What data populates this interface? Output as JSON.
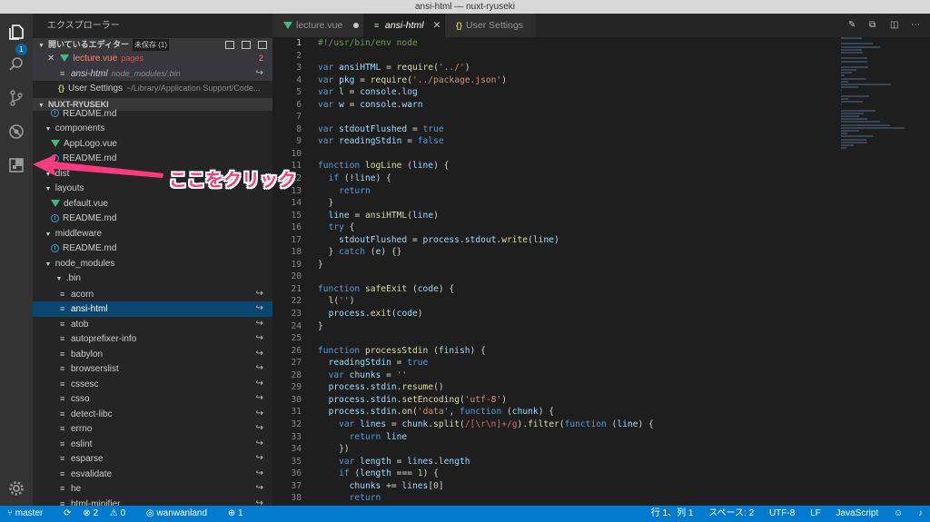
{
  "window": {
    "title": "ansi-html — nuxt-ryuseki"
  },
  "activity_bar": {
    "icons": [
      "files-icon",
      "search-icon",
      "source-control-icon",
      "debug-icon",
      "extensions-icon",
      "gear-icon"
    ],
    "badge": "1"
  },
  "sidebar": {
    "title": "エクスプローラー",
    "open_editors": {
      "label": "開いているエディター",
      "tag": "未保存 (1)",
      "items": [
        {
          "name": "lecture.vue",
          "desc": "pages",
          "count": "2"
        },
        {
          "name": "ansi-html",
          "desc": "node_modules/.bin"
        },
        {
          "name": "User Settings",
          "desc": "~/Library/Application Support/Code..."
        }
      ]
    },
    "project": {
      "label": "NUXT-RYUSEKI",
      "rows": [
        {
          "label": "README.md",
          "type": "info",
          "indent": 1
        },
        {
          "label": "components",
          "type": "folder-open",
          "indent": 0
        },
        {
          "label": "AppLogo.vue",
          "type": "vue",
          "indent": 1
        },
        {
          "label": "README.md",
          "type": "info",
          "indent": 1
        },
        {
          "label": "dist",
          "type": "folder-open",
          "indent": 0
        },
        {
          "label": "layouts",
          "type": "folder-open",
          "indent": 0
        },
        {
          "label": "default.vue",
          "type": "vue",
          "indent": 1
        },
        {
          "label": "README.md",
          "type": "info",
          "indent": 1
        },
        {
          "label": "middleware",
          "type": "folder-open",
          "indent": 0
        },
        {
          "label": "README.md",
          "type": "info",
          "indent": 1
        },
        {
          "label": "node_modules",
          "type": "folder-open",
          "indent": 0
        },
        {
          "label": ".bin",
          "type": "folder-open",
          "indent": 1
        },
        {
          "label": "acorn",
          "type": "file",
          "indent": 2,
          "link": true
        },
        {
          "label": "ansi-html",
          "type": "file",
          "indent": 2,
          "link": true,
          "selected": true
        },
        {
          "label": "atob",
          "type": "file",
          "indent": 2,
          "link": true
        },
        {
          "label": "autoprefixer-info",
          "type": "file",
          "indent": 2,
          "link": true
        },
        {
          "label": "babylon",
          "type": "file",
          "indent": 2,
          "link": true
        },
        {
          "label": "browserslist",
          "type": "file",
          "indent": 2,
          "link": true
        },
        {
          "label": "cssesc",
          "type": "file",
          "indent": 2,
          "link": true
        },
        {
          "label": "csso",
          "type": "file",
          "indent": 2,
          "link": true
        },
        {
          "label": "detect-libc",
          "type": "file",
          "indent": 2,
          "link": true
        },
        {
          "label": "errno",
          "type": "file",
          "indent": 2,
          "link": true
        },
        {
          "label": "eslint",
          "type": "file",
          "indent": 2,
          "link": true
        },
        {
          "label": "esparse",
          "type": "file",
          "indent": 2,
          "link": true
        },
        {
          "label": "esvalidate",
          "type": "file",
          "indent": 2,
          "link": true
        },
        {
          "label": "he",
          "type": "file",
          "indent": 2,
          "link": true
        },
        {
          "label": "html-minifier",
          "type": "file",
          "indent": 2,
          "link": true
        }
      ]
    }
  },
  "editor": {
    "tabs": [
      {
        "label": "lecture.vue",
        "icon": "vue",
        "dirty": true
      },
      {
        "label": "ansi-html",
        "icon": "file",
        "active": true
      },
      {
        "label": "User Settings",
        "icon": "json"
      }
    ],
    "lines": [
      {
        "n": "1",
        "c": [
          [
            "cm",
            "#!/usr/bin/env node"
          ]
        ]
      },
      {
        "n": "2",
        "c": []
      },
      {
        "n": "3",
        "c": [
          [
            "kw",
            "var "
          ],
          [
            "va",
            "ansiHTML"
          ],
          [
            "pl",
            " = "
          ],
          [
            "fn",
            "require"
          ],
          [
            "pl",
            "("
          ],
          [
            "st",
            "'../'"
          ],
          [
            "pl",
            ")"
          ]
        ]
      },
      {
        "n": "4",
        "c": [
          [
            "kw",
            "var "
          ],
          [
            "va",
            "pkg"
          ],
          [
            "pl",
            " = "
          ],
          [
            "fn",
            "require"
          ],
          [
            "pl",
            "("
          ],
          [
            "st",
            "'../package.json'"
          ],
          [
            "pl",
            ")"
          ]
        ]
      },
      {
        "n": "5",
        "c": [
          [
            "kw",
            "var "
          ],
          [
            "va",
            "l"
          ],
          [
            "pl",
            " = "
          ],
          [
            "va",
            "console"
          ],
          [
            "pl",
            "."
          ],
          [
            "va",
            "log"
          ]
        ]
      },
      {
        "n": "6",
        "c": [
          [
            "kw",
            "var "
          ],
          [
            "va",
            "w"
          ],
          [
            "pl",
            " = "
          ],
          [
            "va",
            "console"
          ],
          [
            "pl",
            "."
          ],
          [
            "va",
            "warn"
          ]
        ]
      },
      {
        "n": "7",
        "c": []
      },
      {
        "n": "8",
        "c": [
          [
            "kw",
            "var "
          ],
          [
            "va",
            "stdoutFlushed"
          ],
          [
            "pl",
            " = "
          ],
          [
            "kw",
            "true"
          ]
        ]
      },
      {
        "n": "9",
        "c": [
          [
            "kw",
            "var "
          ],
          [
            "va",
            "readingStdin"
          ],
          [
            "pl",
            " = "
          ],
          [
            "kw",
            "false"
          ]
        ]
      },
      {
        "n": "10",
        "c": []
      },
      {
        "n": "11",
        "c": [
          [
            "kw",
            "function "
          ],
          [
            "fn",
            "logLine"
          ],
          [
            "pl",
            " ("
          ],
          [
            "va",
            "line"
          ],
          [
            "pl",
            ") {"
          ]
        ]
      },
      {
        "n": "12",
        "c": [
          [
            "pl",
            "  "
          ],
          [
            "kw",
            "if"
          ],
          [
            "pl",
            " (!"
          ],
          [
            "va",
            "line"
          ],
          [
            "pl",
            ") {"
          ]
        ]
      },
      {
        "n": "13",
        "c": [
          [
            "pl",
            "    "
          ],
          [
            "kw",
            "return"
          ]
        ]
      },
      {
        "n": "14",
        "c": [
          [
            "pl",
            "  }"
          ]
        ]
      },
      {
        "n": "15",
        "c": [
          [
            "pl",
            "  "
          ],
          [
            "va",
            "line"
          ],
          [
            "pl",
            " = "
          ],
          [
            "fn",
            "ansiHTML"
          ],
          [
            "pl",
            "("
          ],
          [
            "va",
            "line"
          ],
          [
            "pl",
            ")"
          ]
        ]
      },
      {
        "n": "16",
        "c": [
          [
            "pl",
            "  "
          ],
          [
            "kw",
            "try"
          ],
          [
            "pl",
            " {"
          ]
        ]
      },
      {
        "n": "17",
        "c": [
          [
            "pl",
            "    "
          ],
          [
            "va",
            "stdoutFlushed"
          ],
          [
            "pl",
            " = "
          ],
          [
            "va",
            "process"
          ],
          [
            "pl",
            "."
          ],
          [
            "va",
            "stdout"
          ],
          [
            "pl",
            "."
          ],
          [
            "fn",
            "write"
          ],
          [
            "pl",
            "("
          ],
          [
            "va",
            "line"
          ],
          [
            "pl",
            ")"
          ]
        ]
      },
      {
        "n": "18",
        "c": [
          [
            "pl",
            "  } "
          ],
          [
            "kw",
            "catch"
          ],
          [
            "pl",
            " ("
          ],
          [
            "va",
            "e"
          ],
          [
            "pl",
            ") {}"
          ]
        ]
      },
      {
        "n": "19",
        "c": [
          [
            "pl",
            "}"
          ]
        ]
      },
      {
        "n": "20",
        "c": []
      },
      {
        "n": "21",
        "c": [
          [
            "kw",
            "function "
          ],
          [
            "fn",
            "safeExit"
          ],
          [
            "pl",
            " ("
          ],
          [
            "va",
            "code"
          ],
          [
            "pl",
            ") {"
          ]
        ]
      },
      {
        "n": "22",
        "c": [
          [
            "pl",
            "  "
          ],
          [
            "fn",
            "l"
          ],
          [
            "pl",
            "("
          ],
          [
            "st",
            "''"
          ],
          [
            "pl",
            ")"
          ]
        ]
      },
      {
        "n": "23",
        "c": [
          [
            "pl",
            "  "
          ],
          [
            "va",
            "process"
          ],
          [
            "pl",
            "."
          ],
          [
            "fn",
            "exit"
          ],
          [
            "pl",
            "("
          ],
          [
            "va",
            "code"
          ],
          [
            "pl",
            ")"
          ]
        ]
      },
      {
        "n": "24",
        "c": [
          [
            "pl",
            "}"
          ]
        ]
      },
      {
        "n": "25",
        "c": []
      },
      {
        "n": "26",
        "c": [
          [
            "kw",
            "function "
          ],
          [
            "fn",
            "processStdin"
          ],
          [
            "pl",
            " ("
          ],
          [
            "va",
            "finish"
          ],
          [
            "pl",
            ") {"
          ]
        ]
      },
      {
        "n": "27",
        "c": [
          [
            "pl",
            "  "
          ],
          [
            "va",
            "readingStdin"
          ],
          [
            "pl",
            " = "
          ],
          [
            "kw",
            "true"
          ]
        ]
      },
      {
        "n": "28",
        "c": [
          [
            "pl",
            "  "
          ],
          [
            "kw",
            "var "
          ],
          [
            "va",
            "chunks"
          ],
          [
            "pl",
            " = "
          ],
          [
            "st",
            "''"
          ]
        ]
      },
      {
        "n": "29",
        "c": [
          [
            "pl",
            "  "
          ],
          [
            "va",
            "process"
          ],
          [
            "pl",
            "."
          ],
          [
            "va",
            "stdin"
          ],
          [
            "pl",
            "."
          ],
          [
            "fn",
            "resume"
          ],
          [
            "pl",
            "()"
          ]
        ]
      },
      {
        "n": "30",
        "c": [
          [
            "pl",
            "  "
          ],
          [
            "va",
            "process"
          ],
          [
            "pl",
            "."
          ],
          [
            "va",
            "stdin"
          ],
          [
            "pl",
            "."
          ],
          [
            "fn",
            "setEncoding"
          ],
          [
            "pl",
            "("
          ],
          [
            "st",
            "'utf-8'"
          ],
          [
            "pl",
            ")"
          ]
        ]
      },
      {
        "n": "31",
        "c": [
          [
            "pl",
            "  "
          ],
          [
            "va",
            "process"
          ],
          [
            "pl",
            "."
          ],
          [
            "va",
            "stdin"
          ],
          [
            "pl",
            "."
          ],
          [
            "fn",
            "on"
          ],
          [
            "pl",
            "("
          ],
          [
            "st",
            "'data'"
          ],
          [
            "pl",
            ", "
          ],
          [
            "kw",
            "function"
          ],
          [
            "pl",
            " ("
          ],
          [
            "va",
            "chunk"
          ],
          [
            "pl",
            ") {"
          ]
        ]
      },
      {
        "n": "32",
        "c": [
          [
            "pl",
            "    "
          ],
          [
            "kw",
            "var "
          ],
          [
            "va",
            "lines"
          ],
          [
            "pl",
            " = "
          ],
          [
            "va",
            "chunk"
          ],
          [
            "pl",
            "."
          ],
          [
            "fn",
            "split"
          ],
          [
            "pl",
            "("
          ],
          [
            "rx",
            "/[\\r\\n]+/g"
          ],
          [
            "pl",
            ")."
          ],
          [
            "fn",
            "filter"
          ],
          [
            "pl",
            "("
          ],
          [
            "kw",
            "function"
          ],
          [
            "pl",
            " ("
          ],
          [
            "va",
            "line"
          ],
          [
            "pl",
            ") {"
          ]
        ]
      },
      {
        "n": "33",
        "c": [
          [
            "pl",
            "      "
          ],
          [
            "kw",
            "return "
          ],
          [
            "va",
            "line"
          ]
        ]
      },
      {
        "n": "34",
        "c": [
          [
            "pl",
            "    })"
          ]
        ]
      },
      {
        "n": "35",
        "c": [
          [
            "pl",
            "    "
          ],
          [
            "kw",
            "var "
          ],
          [
            "va",
            "length"
          ],
          [
            "pl",
            " = "
          ],
          [
            "va",
            "lines"
          ],
          [
            "pl",
            "."
          ],
          [
            "va",
            "length"
          ]
        ]
      },
      {
        "n": "36",
        "c": [
          [
            "pl",
            "    "
          ],
          [
            "kw",
            "if"
          ],
          [
            "pl",
            " ("
          ],
          [
            "va",
            "length"
          ],
          [
            "pl",
            " === "
          ],
          [
            "nm",
            "1"
          ],
          [
            "pl",
            ") {"
          ]
        ]
      },
      {
        "n": "37",
        "c": [
          [
            "pl",
            "      "
          ],
          [
            "va",
            "chunks"
          ],
          [
            "pl",
            " += "
          ],
          [
            "va",
            "lines"
          ],
          [
            "pl",
            "["
          ],
          [
            "nm",
            "0"
          ],
          [
            "pl",
            "]"
          ]
        ]
      },
      {
        "n": "38",
        "c": [
          [
            "pl",
            "      "
          ],
          [
            "kw",
            "return"
          ]
        ]
      },
      {
        "n": "39",
        "c": [
          [
            "pl",
            "    }"
          ]
        ]
      }
    ]
  },
  "statusbar": {
    "branch": "master",
    "errors": "2",
    "warnings": "0",
    "user": "wanwanland",
    "sync": "1",
    "position": "行 1、列 1",
    "spaces": "スペース: 2",
    "encoding": "UTF-8",
    "eol": "LF",
    "language": "JavaScript"
  },
  "annotation": {
    "text": "ここをクリック",
    "color": "#ff3b7f"
  }
}
